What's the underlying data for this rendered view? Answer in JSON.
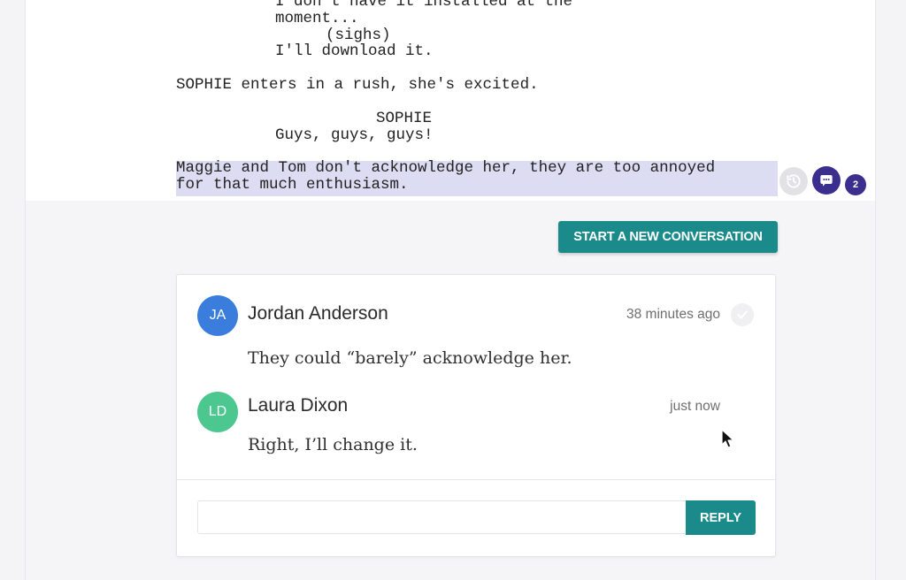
{
  "script": {
    "lines": [
      "I don't have it installed at the",
      "moment...",
      "(sighs)",
      "I'll download it.",
      "SOPHIE enters in a rush, she's excited.",
      "SOPHIE",
      "Guys, guys, guys!",
      "Maggie and Tom don't acknowledge her, they are too annoyed",
      "for that much enthusiasm."
    ],
    "comment_count": "2"
  },
  "icons": {
    "history": "history-icon",
    "comment": "comment-icon",
    "resolve": "check-icon",
    "cursor": "mouse-pointer-icon"
  },
  "toolbar": {
    "new_conversation_label": "START A NEW CONVERSATION"
  },
  "thread": {
    "comments": [
      {
        "initials": "JA",
        "author": "Jordan Anderson",
        "time": "38 minutes ago",
        "text": "They could “barely” acknowledge her.",
        "avatar_color": "#3b7ddd"
      },
      {
        "initials": "LD",
        "author": "Laura Dixon",
        "time": "just now",
        "text": "Right, I’ll change it.",
        "avatar_color": "#4cc790"
      }
    ],
    "reply_value": "",
    "reply_label": "REPLY"
  },
  "colors": {
    "accent": "#1a8a8a",
    "comment_badge": "#3a2e8f",
    "highlight": "#dcdcf3"
  }
}
